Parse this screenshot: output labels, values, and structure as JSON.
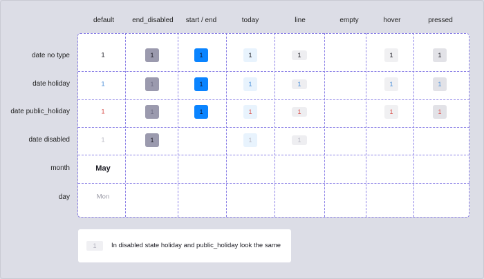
{
  "columns": [
    "default",
    "end_disabled",
    "start / end",
    "today",
    "line",
    "empty",
    "hover",
    "pressed"
  ],
  "rows": [
    "date no type",
    "date holiday",
    "date public_holiday",
    "date disabled",
    "month",
    "day"
  ],
  "cells": {
    "day_value": "1",
    "month_value": "May",
    "day_name_value": "Mon"
  },
  "note": {
    "chip_value": "1",
    "text": "In disabled state holiday and public_holiday look the same"
  },
  "colors": {
    "background": "#dcdde6",
    "dashed_border": "#8a7fe6",
    "selected_blue": "#0a84ff",
    "disabled_gray": "#9b9aae",
    "today_tint": "#e8f3fd",
    "line_gray": "#eeeef1",
    "hover_gray": "#f0f0f2",
    "pressed_gray": "#e2e2e7",
    "holiday_blue": "#4a8fd9",
    "public_holiday_red": "#d9534f",
    "disabled_text": "#b9b9c4"
  }
}
